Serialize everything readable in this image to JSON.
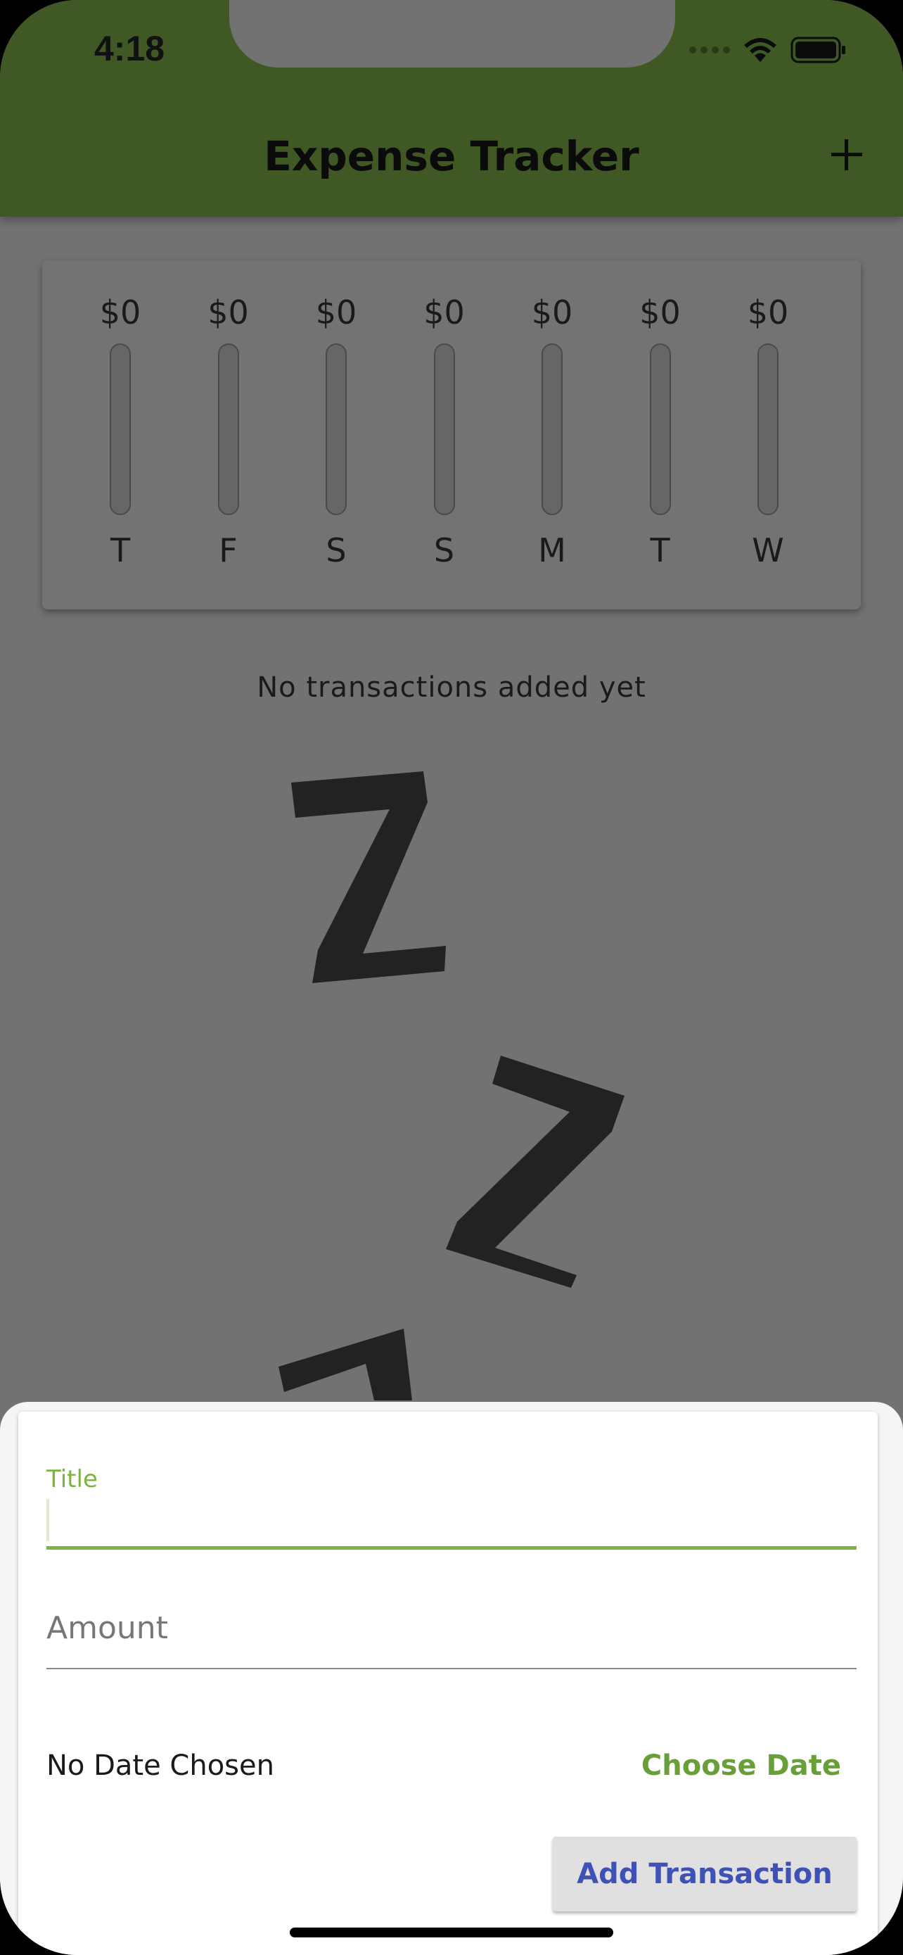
{
  "status_bar": {
    "time": "4:18"
  },
  "app_bar": {
    "title": "Expense Tracker"
  },
  "chart": {
    "bars": [
      {
        "day": "T",
        "amount": "$0",
        "fill": 0
      },
      {
        "day": "F",
        "amount": "$0",
        "fill": 0
      },
      {
        "day": "S",
        "amount": "$0",
        "fill": 0
      },
      {
        "day": "S",
        "amount": "$0",
        "fill": 0
      },
      {
        "day": "M",
        "amount": "$0",
        "fill": 0
      },
      {
        "day": "T",
        "amount": "$0",
        "fill": 0
      },
      {
        "day": "W",
        "amount": "$0",
        "fill": 0
      }
    ]
  },
  "transactions": {
    "empty_message": "No transactions added yet"
  },
  "form": {
    "title_label": "Title",
    "title_value": "",
    "amount_placeholder": "Amount",
    "date_text": "No Date Chosen",
    "choose_date_label": "Choose Date",
    "submit_label": "Add Transaction"
  },
  "colors": {
    "primary": "#405823",
    "accent": "#7cb342",
    "button_text": "#3f51b5"
  }
}
